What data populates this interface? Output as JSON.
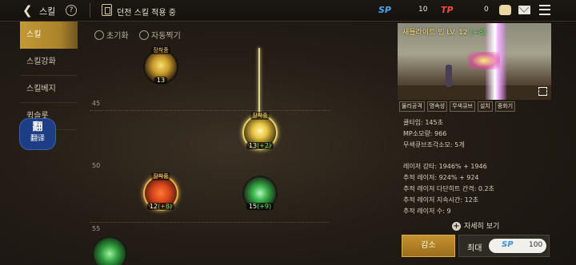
{
  "header": {
    "back_icon": "back-arrow-icon",
    "title": "스킬",
    "help_icon": "question-icon",
    "dungeon_icon": "dungeon-door-icon",
    "dungeon_label": "던전 스킬 적용 중",
    "sp_label": "SP",
    "sp_value": "10",
    "tp_label": "TP",
    "tp_value": "0",
    "icons": [
      "gold-pouch-icon",
      "mail-icon",
      "menu-icon"
    ],
    "colors": {
      "sp": "#4fa3f2",
      "tp": "#f04a45"
    }
  },
  "sidebar": {
    "items": [
      {
        "label": "스킬",
        "active": true
      },
      {
        "label": "스킬강화",
        "active": false
      },
      {
        "label": "스킬베지",
        "active": false
      },
      {
        "label": "퀵슬롯",
        "active": false
      }
    ],
    "translate_icon": "翻",
    "translate_label": "翻译"
  },
  "tree": {
    "reset_label": "초기화",
    "autolearn_label": "자동찍기",
    "levels": [
      "45",
      "50",
      "55"
    ],
    "skills": [
      {
        "badge": "장착중",
        "level": "13",
        "plus": ""
      },
      {
        "badge": "장착중",
        "level": "13",
        "plus": "(+2)"
      },
      {
        "badge": "장착중",
        "level": "12",
        "plus": "(+8)"
      },
      {
        "badge": "",
        "level": "15",
        "plus": "(+9)"
      },
      {
        "badge": "",
        "level": "",
        "plus": ""
      }
    ]
  },
  "detail": {
    "preview_title": "새틀라이트 빔 LV. 12",
    "preview_title_suffix": "(+8)",
    "tags": [
      "물리공격",
      "명속성",
      "무색큐브",
      "설치",
      "중화기"
    ],
    "cooldown": "쿨타임: 145초",
    "mp_cost": "MP소모량: 966",
    "cube_cost": "무색큐브조각소모: 5개",
    "laser_strength": "레이저 강타: 1946% + 1946",
    "tracking_laser": "추적 레이저: 924% + 924",
    "multi_hit_interval": "추적 레이저 다단히트 간격: 0.2초",
    "duration": "추적 레이저 지속시간: 12초",
    "laser_count": "추적 레이저 수: 9",
    "more_label": "자세히 보기",
    "decrease_label": "감소",
    "max_label": "최대",
    "sp_label": "SP",
    "sp_value": "100"
  }
}
